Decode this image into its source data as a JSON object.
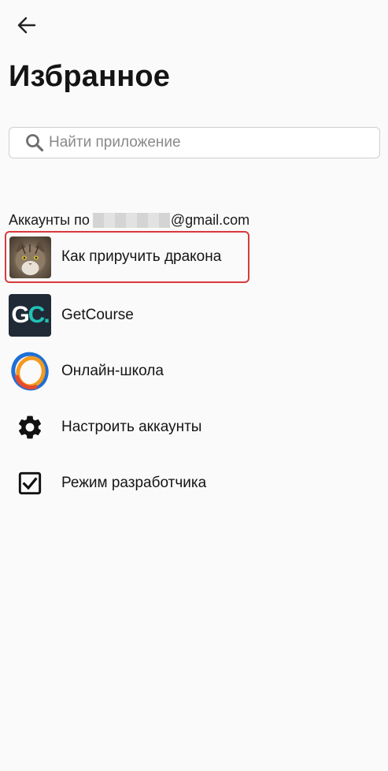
{
  "header": {
    "title": "Избранное"
  },
  "search": {
    "placeholder": "Найти приложение"
  },
  "accounts": {
    "prefix": "Аккаунты по",
    "email_suffix": "@gmail.com"
  },
  "items": [
    {
      "label": "Как приручить дракона",
      "icon": "avatar-icon",
      "highlighted": true
    },
    {
      "label": "GetCourse",
      "icon": "getcourse-logo-icon",
      "logo_text_1": "G",
      "logo_text_2": "C."
    },
    {
      "label": "Онлайн-школа",
      "icon": "online-school-logo-icon"
    },
    {
      "label": "Настроить аккаунты",
      "icon": "gear-icon"
    },
    {
      "label": "Режим разработчика",
      "icon": "checkbox-icon"
    }
  ],
  "colors": {
    "highlight": "#d9393d",
    "gc_bg": "#1f2a36",
    "gc_accent": "#22c1b6"
  }
}
